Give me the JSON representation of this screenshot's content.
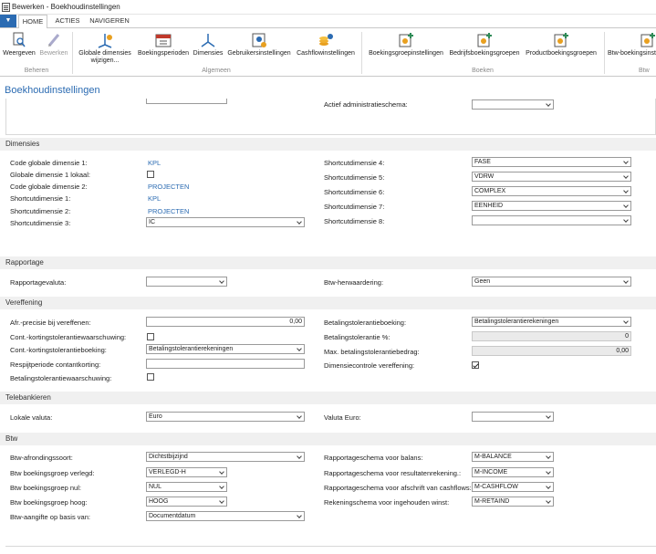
{
  "window": {
    "title": "Bewerken - Boekhoudinstellingen"
  },
  "tabs": {
    "home": "HOME",
    "actions": "ACTIES",
    "navigate": "NAVIGEREN"
  },
  "ribbon": {
    "view": "Weergeven",
    "edit": "Bewerken",
    "group_manage": "Beheren",
    "global_dims_1": "Globale dimensies",
    "global_dims_2": "wijzigen...",
    "periods": "Boekingsperioden",
    "dims": "Dimensies",
    "user_settings": "Gebruikersinstellingen",
    "cashflow": "Cashflowinstellingen",
    "group_general": "Algemeen",
    "post_group_settings": "Boekingsgroepinstellingen",
    "bus_post_groups": "Bedrijfsboekingsgroepen",
    "prod_post_groups": "Productboekingsgroepen",
    "vat_post_groups": "Btw-boekingsinst",
    "group_groups": "Boeken",
    "group_vat": "Btw"
  },
  "page": {
    "title": "Boekhoudinstellingen"
  },
  "top": {
    "active_scheme": "Actief administratieschema:"
  },
  "dimensions": {
    "header": "Dimensies",
    "left": [
      {
        "label": "Code globale dimensie 1:",
        "value": "KPL"
      },
      {
        "label": "Globale dimensie 1 lokaal:",
        "value": ""
      },
      {
        "label": "Code globale dimensie 2:",
        "value": "PROJECTEN"
      },
      {
        "label": "Shortcutdimensie 1:",
        "value": "KPL"
      },
      {
        "label": "Shortcutdimensie 2:",
        "value": "PROJECTEN"
      },
      {
        "label": "Shortcutdimensie 3:",
        "value": "IC"
      }
    ],
    "right": [
      {
        "label": "Shortcutdimensie 4:",
        "value": "FASE"
      },
      {
        "label": "Shortcutdimensie 5:",
        "value": "VDRW"
      },
      {
        "label": "Shortcutdimensie 6:",
        "value": "COMPLEX"
      },
      {
        "label": "Shortcutdimensie 7:",
        "value": "EENHEID"
      },
      {
        "label": "Shortcutdimensie 8:",
        "value": ""
      }
    ]
  },
  "reporting": {
    "header": "Rapportage",
    "currency_label": "Rapportagevaluta:",
    "currency_value": "",
    "vat_reval_label": "Btw-herwaardering:",
    "vat_reval_value": "Geen"
  },
  "settlement": {
    "header": "Vereffening",
    "left": [
      {
        "label": "Afr.-precisie bij vereffenen:",
        "value": "0,00"
      },
      {
        "label": "Cont.-kortingstolerantiewaarschuwing:",
        "value": ""
      },
      {
        "label": "Cont.-kortingstolerantieboeking:",
        "value": "Betalingstolerantierekeningen"
      },
      {
        "label": "Respijtperiode contantkorting:",
        "value": ""
      },
      {
        "label": "Betalingstolerantiewaarschuwing:",
        "value": ""
      }
    ],
    "right": [
      {
        "label": "Betalingstolerantieboeking:",
        "value": "Betalingstolerantierekeningen"
      },
      {
        "label": "Betalingstolerantie %:",
        "value": "0"
      },
      {
        "label": "Max. betalingstolerantiebedrag:",
        "value": "0,00"
      },
      {
        "label": "Dimensiecontrole vereffening:",
        "value": ""
      }
    ]
  },
  "telebanking": {
    "header": "Telebankieren",
    "local_label": "Lokale valuta:",
    "local_value": "Euro",
    "euro_label": "Valuta Euro:",
    "euro_value": ""
  },
  "vat": {
    "header": "Btw",
    "left": [
      {
        "label": "Btw-afrondingssoort:",
        "value": "Dichtstbijzijnd"
      },
      {
        "label": "Btw boekingsgroep verlegd:",
        "value": "VERLEGD-H"
      },
      {
        "label": "Btw boekingsgroep nul:",
        "value": "NUL"
      },
      {
        "label": "Btw boekingsgroep hoog:",
        "value": "HOOG"
      },
      {
        "label": "Btw-aangifte op basis van:",
        "value": "Documentdatum"
      }
    ],
    "right": [
      {
        "label": "Rapportageschema voor balans:",
        "value": "M-BALANCE"
      },
      {
        "label": "Rapportageschema voor resultatenrekening.:",
        "value": "M-INCOME"
      },
      {
        "label": "Rapportageschema voor afschrift van cashflows:",
        "value": "M-CASHFLOW"
      },
      {
        "label": "Rekeningschema voor ingehouden winst:",
        "value": "M-RETAIND"
      }
    ]
  },
  "colors": {
    "accent": "#2b6bb2",
    "section_bg": "#f0f0f0"
  }
}
